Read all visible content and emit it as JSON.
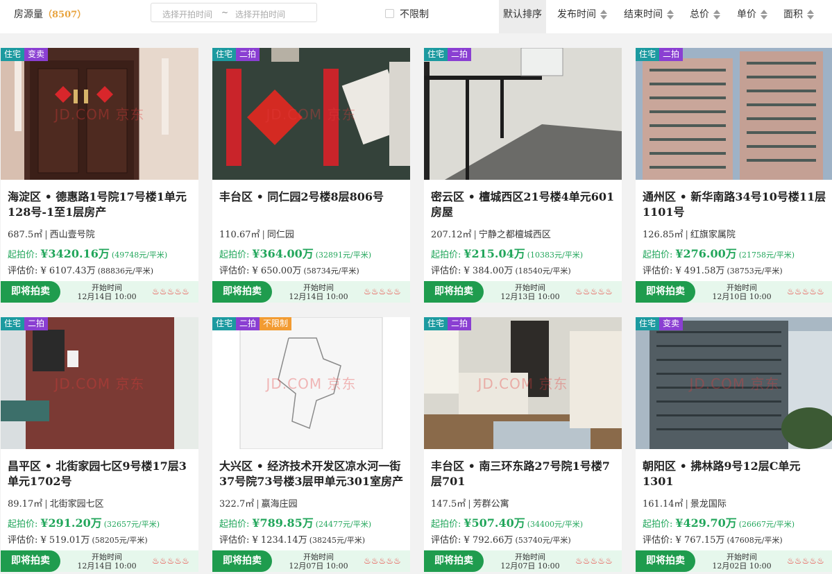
{
  "header": {
    "count_label": "房源量",
    "count_open": "（",
    "count_value": "8507",
    "count_close": "）",
    "date_start_placeholder": "选择开拍时间",
    "date_sep": "~",
    "date_end_placeholder": "选择开拍时间",
    "unlimited_label": "不限制",
    "sorts": [
      "默认排序",
      "发布时间",
      "结束时间",
      "总价",
      "单价",
      "面积"
    ]
  },
  "common": {
    "start_label": "起拍价:",
    "appraisal_label": "评估价:",
    "bid_button": "即将拍卖",
    "start_time_label": "开始时间",
    "flames": "♨♨♨♨♨",
    "watermark": "JD.COM 京东"
  },
  "colors": {
    "accent_green": "#1f9c4e",
    "price_green": "#22a65b",
    "tag_residential": "#1c9aa0",
    "tag_purple": "#8a3fd2",
    "tag_orange": "#f29b32",
    "count_orange": "#e8a33d"
  },
  "listings": [
    {
      "tags": [
        "住宅",
        "变卖"
      ],
      "title": "海淀区 • 德惠路1号院17号楼1单元128号-1至1层房产",
      "area": "687.5㎡",
      "community": "西山壹号院",
      "start_price": "¥3420.16万",
      "start_unit": "(49748元/平米)",
      "appraisal": "¥ 6107.43万",
      "appraisal_unit": "(88836元/平米)",
      "time": "12月14日 10:00"
    },
    {
      "tags": [
        "住宅",
        "二拍"
      ],
      "title": "丰台区 • 同仁园2号楼8层806号",
      "area": "110.67㎡",
      "community": "同仁园",
      "start_price": "¥364.00万",
      "start_unit": "(32891元/平米)",
      "appraisal": "¥ 650.00万",
      "appraisal_unit": "(58734元/平米)",
      "time": "12月14日 10:00"
    },
    {
      "tags": [
        "住宅",
        "二拍"
      ],
      "title": "密云区 • 檀城西区21号楼4单元601房屋",
      "area": "207.12㎡",
      "community": "宁静之都檀城西区",
      "start_price": "¥215.04万",
      "start_unit": "(10383元/平米)",
      "appraisal": "¥ 384.00万",
      "appraisal_unit": "(18540元/平米)",
      "time": "12月13日 10:00"
    },
    {
      "tags": [
        "住宅",
        "二拍"
      ],
      "title": "通州区 • 新华南路34号10号楼11层1101号",
      "area": "126.85㎡",
      "community": "红旗家属院",
      "start_price": "¥276.00万",
      "start_unit": "(21758元/平米)",
      "appraisal": "¥ 491.58万",
      "appraisal_unit": "(38753元/平米)",
      "time": "12月10日 10:00"
    },
    {
      "tags": [
        "住宅",
        "二拍"
      ],
      "title": "昌平区 • 北街家园七区9号楼17层3单元1702号",
      "area": "89.17㎡",
      "community": "北街家园七区",
      "start_price": "¥291.20万",
      "start_unit": "(32657元/平米)",
      "appraisal": "¥ 519.01万",
      "appraisal_unit": "(58205元/平米)",
      "time": "12月14日 10:00"
    },
    {
      "tags": [
        "住宅",
        "二拍",
        "不限制"
      ],
      "title": "大兴区 • 经济技术开发区凉水河一街37号院73号楼3层甲单元301室房产",
      "area": "322.7㎡",
      "community": "嬴海庄园",
      "start_price": "¥789.85万",
      "start_unit": "(24477元/平米)",
      "appraisal": "¥ 1234.14万",
      "appraisal_unit": "(38245元/平米)",
      "time": "12月07日 10:00"
    },
    {
      "tags": [
        "住宅",
        "二拍"
      ],
      "title": "丰台区 • 南三环东路27号院1号楼7层701",
      "area": "147.5㎡",
      "community": "芳群公寓",
      "start_price": "¥507.40万",
      "start_unit": "(34400元/平米)",
      "appraisal": "¥ 792.66万",
      "appraisal_unit": "(53740元/平米)",
      "time": "12月07日 10:00"
    },
    {
      "tags": [
        "住宅",
        "变卖"
      ],
      "title": "朝阳区 • 拂林路9号12层C单元1301",
      "area": "161.14㎡",
      "community": "景龙国际",
      "start_price": "¥429.70万",
      "start_unit": "(26667元/平米)",
      "appraisal": "¥ 767.15万",
      "appraisal_unit": "(47608元/平米)",
      "time": "12月02日 10:00"
    }
  ]
}
